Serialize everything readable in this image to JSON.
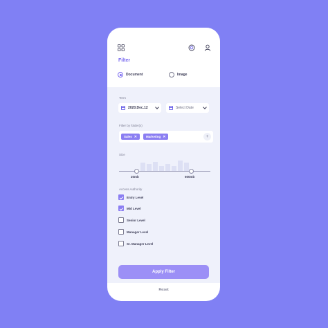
{
  "screen": {
    "title": "Filter"
  },
  "icons": {
    "menu": "grid-icon",
    "scan": "scan-icon",
    "profile": "user-icon"
  },
  "doc_type": {
    "options": [
      {
        "label": "Document",
        "selected": true
      },
      {
        "label": "Image",
        "selected": false
      }
    ]
  },
  "term": {
    "label": "Term",
    "date_value": "2020.Dec.12",
    "date_placeholder": "Select Date"
  },
  "folders": {
    "label": "Filter by folder(s)",
    "chips": [
      {
        "label": "Sales"
      },
      {
        "label": "Marketing"
      }
    ],
    "add_symbol": "+"
  },
  "size": {
    "label": "Size",
    "min_label": "20mb",
    "max_label": "500mb"
  },
  "access": {
    "label": "Access Authority",
    "levels": [
      {
        "label": "Entry Level",
        "checked": true
      },
      {
        "label": "Mid Level",
        "checked": true
      },
      {
        "label": "Senior Level",
        "checked": false
      },
      {
        "label": "Manager Level",
        "checked": false
      },
      {
        "label": "Sr. Manager Level",
        "checked": false
      }
    ]
  },
  "actions": {
    "apply_label": "Apply Filter",
    "reset_label": "Reset"
  },
  "colors": {
    "background": "#8080f4",
    "accent": "#8b7ef2",
    "title": "#7b6cf0",
    "panel": "#eff1fb"
  }
}
